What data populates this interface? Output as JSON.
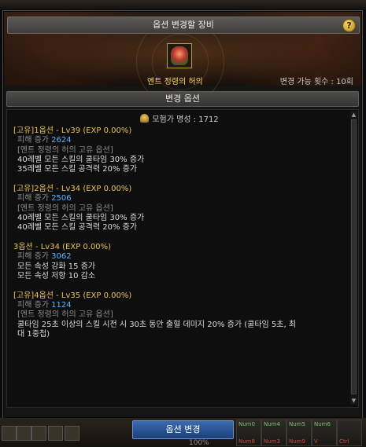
{
  "window": {
    "background_title": "",
    "title": "옵션 변경할 장비",
    "help_label": "?"
  },
  "item": {
    "name": "엔트 정령의 허의",
    "change_count": "변경 가능 횟수 : 10회"
  },
  "section_title": "변경 옵션",
  "fame": "모험가 명성 : 1712",
  "options": [
    {
      "header": "[고유]1옵션 - Lv39 (EXP 0.00%)",
      "stat_label": "피해 증가",
      "stat_value": "2624",
      "subtitle": "[엔트 정령의 허의 고유 옵션]",
      "lines": [
        "40레벨 모든 스킬의 쿨타임 30% 증가",
        "35레벨 모든 스킬 공격력 20% 증가"
      ]
    },
    {
      "header": "[고유]2옵션 - Lv34 (EXP 0.00%)",
      "stat_label": "피해 증가",
      "stat_value": "2506",
      "subtitle": "[엔트 정령의 허의 고유 옵션]",
      "lines": [
        "40레벨 모든 스킬의 쿨타임 30% 증가",
        "40레벨 모든 스킬 공격력 20% 증가"
      ]
    },
    {
      "header": "3옵션 - Lv34 (EXP 0.00%)",
      "stat_label": "피해 증가",
      "stat_value": "3062",
      "subtitle": "",
      "lines": [
        "모든 속성 강화 15 증가",
        "모든 속성 저항 10 감소"
      ]
    },
    {
      "header": "[고유]4옵션 - Lv35 (EXP 0.00%)",
      "stat_label": "피해 증가",
      "stat_value": "1124",
      "subtitle": "[엔트 정령의 허의 고유 옵션]",
      "lines": [
        "쿨타임 25초 이상의 스킬 시전 시 30초 동안 출혈 데미지 20% 증가 (쿨타임 5초, 최",
        "대 1중첩)"
      ]
    }
  ],
  "button": {
    "change_label": "옵션 변경"
  },
  "bottom": {
    "percent": "100%"
  },
  "hotkeys": [
    {
      "key": "Num0",
      "sub": "Num8"
    },
    {
      "key": "Num4",
      "sub": "Num3"
    },
    {
      "key": "Num5",
      "sub": "Num9"
    },
    {
      "key": "Num6",
      "sub": "V"
    },
    {
      "key": "",
      "sub": "Ctrl"
    }
  ]
}
